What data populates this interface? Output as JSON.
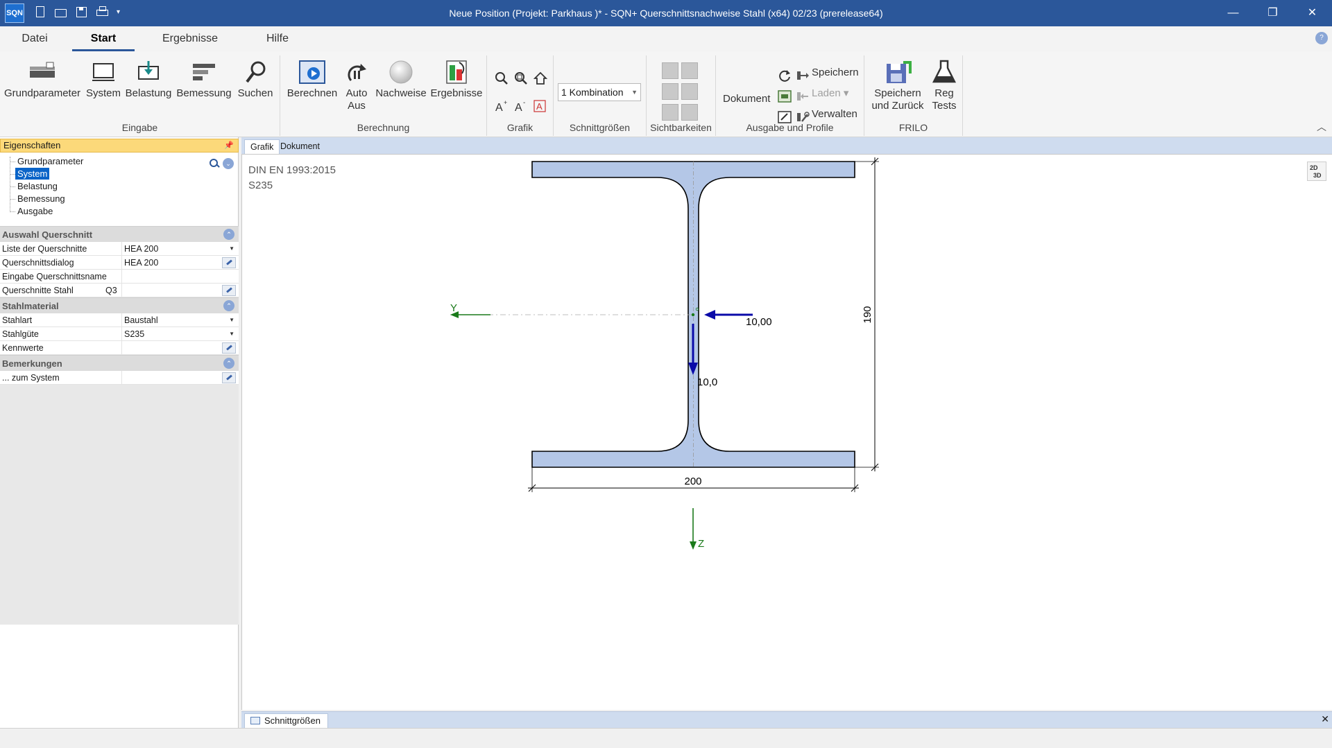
{
  "titlebar": {
    "logo": "SQN",
    "title": "Neue Position (Projekt: Parkhaus )* - SQN+ Querschnittsnachweise Stahl (x64) 02/23 (prerelease64)",
    "minimize": "—",
    "restore": "❐",
    "close": "✕"
  },
  "menu": {
    "tabs": [
      "Datei",
      "Start",
      "Ergebnisse",
      "Hilfe"
    ],
    "active": "Start"
  },
  "ribbon": {
    "groups": {
      "eingabe": "Eingabe",
      "berechnung": "Berechnung",
      "grafik": "Grafik",
      "schnittgroessen": "Schnittgrößen",
      "sichtbarkeiten": "Sichtbarkeiten",
      "ausgabe": "Ausgabe und Profile",
      "frilo": "FRILO"
    },
    "buttons": {
      "grundparameter": "Grundparameter",
      "system": "System",
      "belastung": "Belastung",
      "bemessung": "Bemessung",
      "suchen": "Suchen",
      "berechnen": "Berechnen",
      "auto": "Auto",
      "aus": "Aus",
      "nachweise": "Nachweise",
      "ergebnisse": "Ergebnisse",
      "dokument": "Dokument",
      "speichern": "Speichern",
      "laden": "Laden",
      "verwalten": "Verwalten",
      "speichern_zurueck_1": "Speichern",
      "speichern_zurueck_2": "und Zurück",
      "reg": "Reg",
      "tests": "Tests"
    },
    "kombination": "1 Kombination"
  },
  "left_panel": {
    "header": "Eigenschaften",
    "tree": [
      "Grundparameter",
      "System",
      "Belastung",
      "Bemessung",
      "Ausgabe"
    ],
    "tree_selected": "System",
    "sections": [
      {
        "title": "Auswahl Querschnitt",
        "rows": [
          {
            "name": "Liste der Querschnitte",
            "value": "HEA 200",
            "control": "dropdown"
          },
          {
            "name": "Querschnittsdialog",
            "value": "HEA 200",
            "control": "edit"
          },
          {
            "name": "Eingabe Querschnittsname",
            "value": "",
            "control": "none"
          },
          {
            "name": "Querschnitte Stahl",
            "extra": "Q3",
            "value": "",
            "control": "edit"
          }
        ]
      },
      {
        "title": "Stahlmaterial",
        "rows": [
          {
            "name": "Stahlart",
            "value": "Baustahl",
            "control": "dropdown"
          },
          {
            "name": "Stahlgüte",
            "value": "S235",
            "control": "dropdown"
          },
          {
            "name": "Kennwerte",
            "value": "",
            "control": "edit"
          }
        ]
      },
      {
        "title": "Bemerkungen",
        "rows": [
          {
            "name": "... zum System",
            "value": "",
            "control": "edit"
          }
        ]
      }
    ]
  },
  "doc_tabs": [
    "Grafik",
    "Dokument"
  ],
  "doc_tab_active": "Grafik",
  "canvas": {
    "norm": "DIN EN 1993:2015",
    "material": "S235",
    "view_toggle_top": "2D",
    "view_toggle_bottom": "3D",
    "dim_width": "200",
    "dim_height": "190",
    "axis_y": "Y",
    "axis_z": "Z",
    "load_horizontal": "10,00",
    "load_vertical": "10,0",
    "colors": {
      "section_fill": "#b4c7e7",
      "load_arrow": "#0a0aa8",
      "axis": "#1a7a1a"
    }
  },
  "bottom": {
    "tab": "Schnittgrößen",
    "close": "✕"
  }
}
